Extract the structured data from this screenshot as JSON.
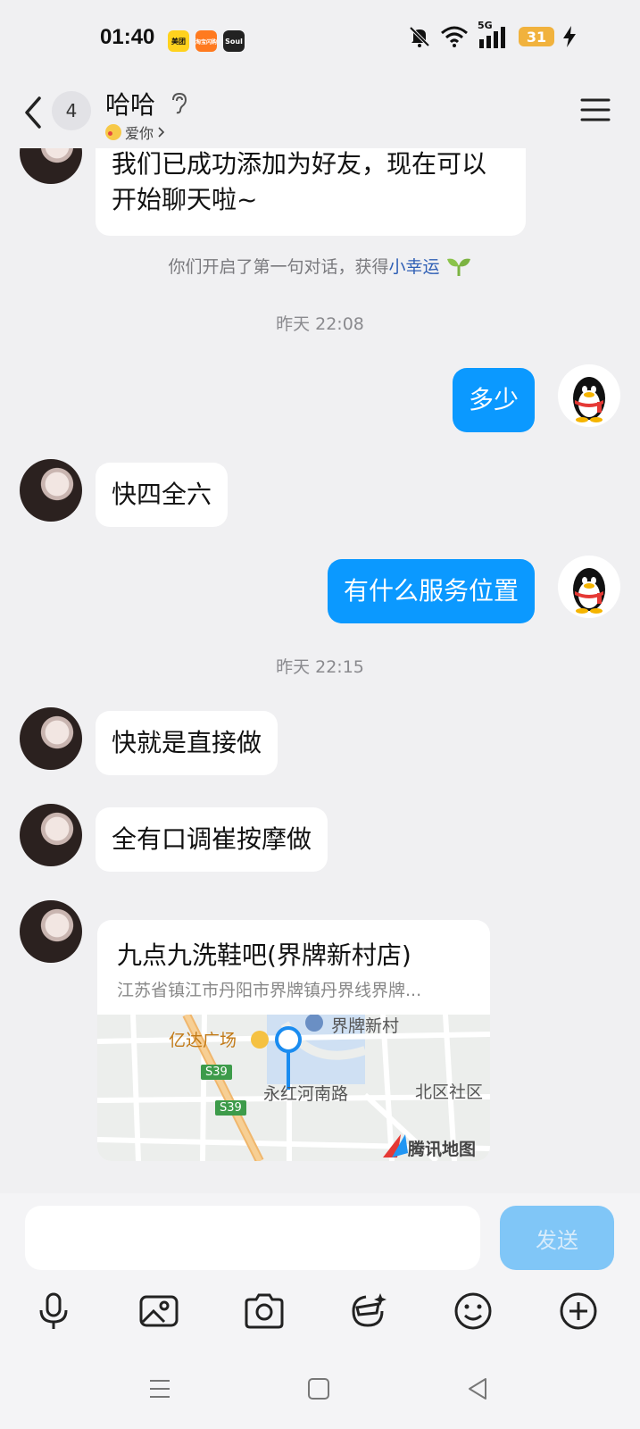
{
  "status_bar": {
    "time": "01:40",
    "apps": [
      "美团",
      "淘宝闪购",
      "Soul"
    ],
    "network": "5G",
    "battery": "31"
  },
  "header": {
    "unread_count": "4",
    "contact_name": "哈哈",
    "status_text": "爱你",
    "icons": [
      "back-icon",
      "ear-icon",
      "menu-icon"
    ]
  },
  "messages": {
    "m1": "我们已成功添加为好友，现在可以开始聊天啦~",
    "system_prefix": "你们开启了第一句对话，获得",
    "system_link": "小幸运",
    "time1": "昨天 22:08",
    "m2": "多少",
    "m3": "快四全六",
    "m4": "有什么服务位置",
    "time2": "昨天 22:15",
    "m5": "快就是直接做",
    "m6": "全有口调崔按摩做"
  },
  "location": {
    "name": "九点九洗鞋吧(界牌新村店)",
    "address": "江苏省镇江市丹阳市界牌镇丹界线界牌...",
    "map_labels": {
      "mall": "亿达广场",
      "village": "界牌新村",
      "road": "永红河南路",
      "community": "北区社区",
      "road_code_1": "S39",
      "road_code_2": "S39",
      "brand": "腾讯地图"
    }
  },
  "input": {
    "placeholder": "",
    "send_label": "发送"
  },
  "toolbar": [
    "mic-icon",
    "image-icon",
    "camera-icon",
    "sticker-icon",
    "emoji-icon",
    "plus-icon"
  ],
  "colors": {
    "accent": "#0b99ff",
    "send_disabled": "#80c6f7",
    "background": "#f0f0f2"
  }
}
